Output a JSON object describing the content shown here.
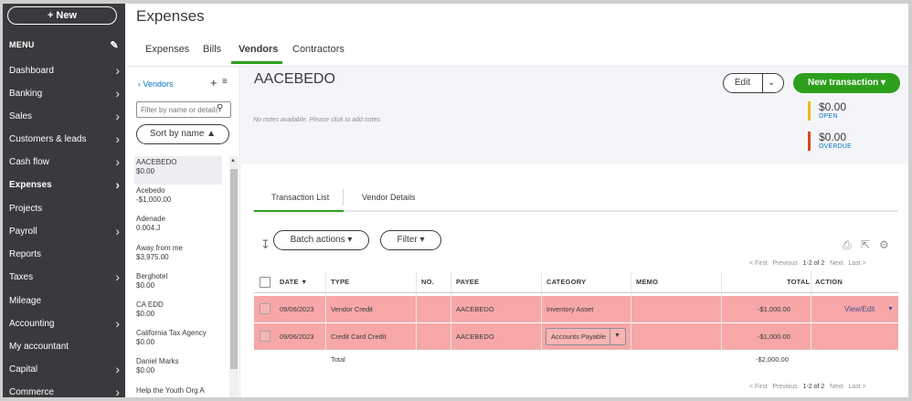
{
  "sidebar": {
    "new_button": "+ New",
    "menu_label": "MENU",
    "items": [
      {
        "label": "Dashboard",
        "chevron": true
      },
      {
        "label": "Banking",
        "chevron": true
      },
      {
        "label": "Sales",
        "chevron": true
      },
      {
        "label": "Customers & leads",
        "chevron": true
      },
      {
        "label": "Cash flow",
        "chevron": true
      },
      {
        "label": "Expenses",
        "chevron": true,
        "active": true
      },
      {
        "label": "Projects",
        "chevron": false
      },
      {
        "label": "Payroll",
        "chevron": true
      },
      {
        "label": "Reports",
        "chevron": false
      },
      {
        "label": "Taxes",
        "chevron": true
      },
      {
        "label": "Mileage",
        "chevron": false
      },
      {
        "label": "Accounting",
        "chevron": true
      },
      {
        "label": "My accountant",
        "chevron": false
      },
      {
        "label": "Capital",
        "chevron": true
      },
      {
        "label": "Commerce",
        "chevron": true
      }
    ]
  },
  "page": {
    "title": "Expenses",
    "tabs": [
      {
        "label": "Expenses"
      },
      {
        "label": "Bills"
      },
      {
        "label": "Vendors",
        "active": true
      },
      {
        "label": "Contractors"
      }
    ]
  },
  "vendor_list": {
    "back_label": "Vendors",
    "filter_placeholder": "Filter by name or details",
    "sort_label": "Sort by name",
    "vendors": [
      {
        "name": "AACEBEDO",
        "balance": "$0.00",
        "selected": true
      },
      {
        "name": "Acebedo",
        "balance": "-$1,000.00"
      },
      {
        "name": "Adenade",
        "balance": "0.004.J"
      },
      {
        "name": "Away from me",
        "balance": "$3,975.00"
      },
      {
        "name": "Berghotel",
        "balance": "$0.00"
      },
      {
        "name": "CA EDD",
        "balance": "$0.00"
      },
      {
        "name": "California Tax Agency",
        "balance": "$0.00"
      },
      {
        "name": "Daniel Marks",
        "balance": "$0.00"
      },
      {
        "name": "Help the Youth Org A",
        "balance": ""
      }
    ]
  },
  "vendor": {
    "name": "AACEBEDO",
    "notes_placeholder": "No notes available. Please click to add notes.",
    "edit_label": "Edit",
    "new_transaction_label": "New transaction",
    "open_amount": "$0.00",
    "open_label": "OPEN",
    "overdue_amount": "$0.00",
    "overdue_label": "OVERDUE",
    "colors": {
      "open": "#f2b41c",
      "overdue": "#d8461c",
      "accent": "#2ca01c",
      "highlight": "#f7a7a7"
    }
  },
  "subtabs": {
    "transaction_list": "Transaction List",
    "vendor_details": "Vendor Details"
  },
  "toolbar": {
    "batch_actions": "Batch actions",
    "filter": "Filter",
    "pager": {
      "first": "< First",
      "previous": "Previous",
      "range": "1-2 of 2",
      "next": "Next",
      "last": "Last >"
    }
  },
  "table": {
    "headers": {
      "date": "DATE ▼",
      "type": "TYPE",
      "no": "NO.",
      "payee": "PAYEE",
      "category": "CATEGORY",
      "memo": "MEMO",
      "total": "TOTAL",
      "action": "ACTION"
    },
    "rows": [
      {
        "date": "09/06/2023",
        "type": "Vendor Credit",
        "no": "",
        "payee": "AACEBEDO",
        "category": "Inventory Asset",
        "memo": "",
        "total": "-$1,000.00",
        "action": "View/Edit"
      },
      {
        "date": "09/06/2023",
        "type": "Credit Card Credit",
        "no": "",
        "payee": "AACEBEDO",
        "category": "Accounts Payable",
        "memo": "",
        "total": "-$1,000.00",
        "action": ""
      }
    ],
    "total_label": "Total",
    "total_value": "-$2,000.00"
  }
}
